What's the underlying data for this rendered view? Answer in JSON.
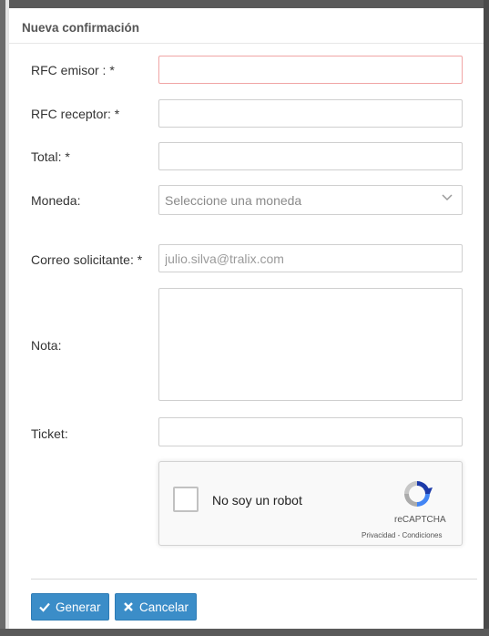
{
  "modal": {
    "title": "Nueva confirmación"
  },
  "form": {
    "rfc_emisor": {
      "label": "RFC emisor : *",
      "value": ""
    },
    "rfc_receptor": {
      "label": "RFC receptor: *",
      "value": ""
    },
    "total": {
      "label": "Total: *",
      "value": ""
    },
    "moneda": {
      "label": "Moneda:",
      "placeholder": "Seleccione una moneda"
    },
    "correo": {
      "label": "Correo solicitante: *",
      "placeholder": "julio.silva@tralix.com"
    },
    "nota": {
      "label": "Nota:",
      "value": ""
    },
    "ticket": {
      "label": "Ticket:",
      "value": ""
    }
  },
  "captcha": {
    "label": "No soy un robot",
    "brand": "reCAPTCHA",
    "links": "Privacidad - Condiciones",
    "icon": "recaptcha-logo-icon"
  },
  "buttons": {
    "generate": {
      "label": "Generar",
      "icon": "check-icon"
    },
    "cancel": {
      "label": "Cancelar",
      "icon": "close-icon"
    }
  },
  "colors": {
    "primary": "#3b8dc8",
    "error_border": "#f0a5a5"
  }
}
